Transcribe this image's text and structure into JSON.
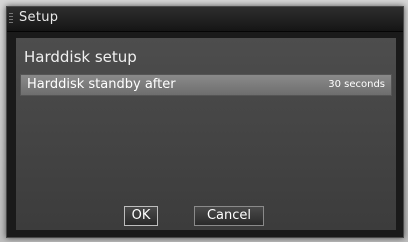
{
  "window": {
    "title": "Setup"
  },
  "panel": {
    "heading": "Harddisk setup"
  },
  "settings": [
    {
      "label": "Harddisk standby after",
      "value": "30 seconds"
    }
  ],
  "buttons": {
    "ok_label": "OK",
    "cancel_label": "Cancel"
  }
}
